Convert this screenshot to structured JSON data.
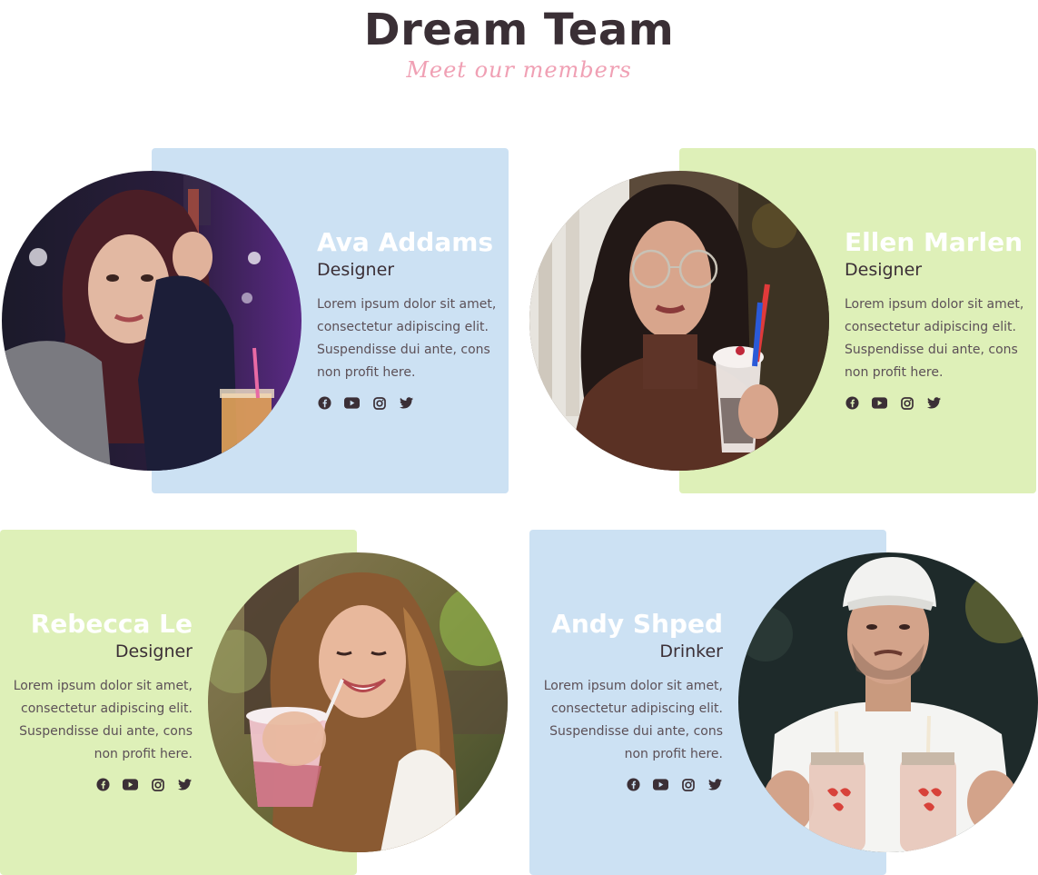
{
  "header": {
    "title": "Dream Team",
    "subtitle": "Meet our members"
  },
  "colors": {
    "panel_blue": "#cce1f3",
    "panel_green": "#def0b8",
    "title": "#3a2f35",
    "subtitle": "#f0a0b4",
    "name": "#ffffff"
  },
  "members": [
    {
      "name": "Ava Addams",
      "role": "Designer",
      "description": "Lorem ipsum dolor sit amet, consectetur adipiscing elit. Suspendisse dui ante, cons non profit here.",
      "panel_color": "blue",
      "socials": [
        "facebook-icon",
        "youtube-icon",
        "instagram-icon",
        "twitter-icon"
      ]
    },
    {
      "name": "Ellen Marlen",
      "role": "Designer",
      "description": "Lorem ipsum dolor sit amet, consectetur adipiscing elit. Suspendisse dui ante, cons non profit here.",
      "panel_color": "green",
      "socials": [
        "facebook-icon",
        "youtube-icon",
        "instagram-icon",
        "twitter-icon"
      ]
    },
    {
      "name": "Rebecca Le",
      "role": "Designer",
      "description": "Lorem ipsum dolor sit amet, consectetur adipiscing elit. Suspendisse dui ante, cons non profit here.",
      "panel_color": "green",
      "socials": [
        "facebook-icon",
        "youtube-icon",
        "instagram-icon",
        "twitter-icon"
      ]
    },
    {
      "name": "Andy Shped",
      "role": "Drinker",
      "description": "Lorem ipsum dolor sit amet, consectetur adipiscing elit. Suspendisse dui ante, cons non profit here.",
      "panel_color": "blue",
      "socials": [
        "facebook-icon",
        "youtube-icon",
        "instagram-icon",
        "twitter-icon"
      ]
    }
  ]
}
